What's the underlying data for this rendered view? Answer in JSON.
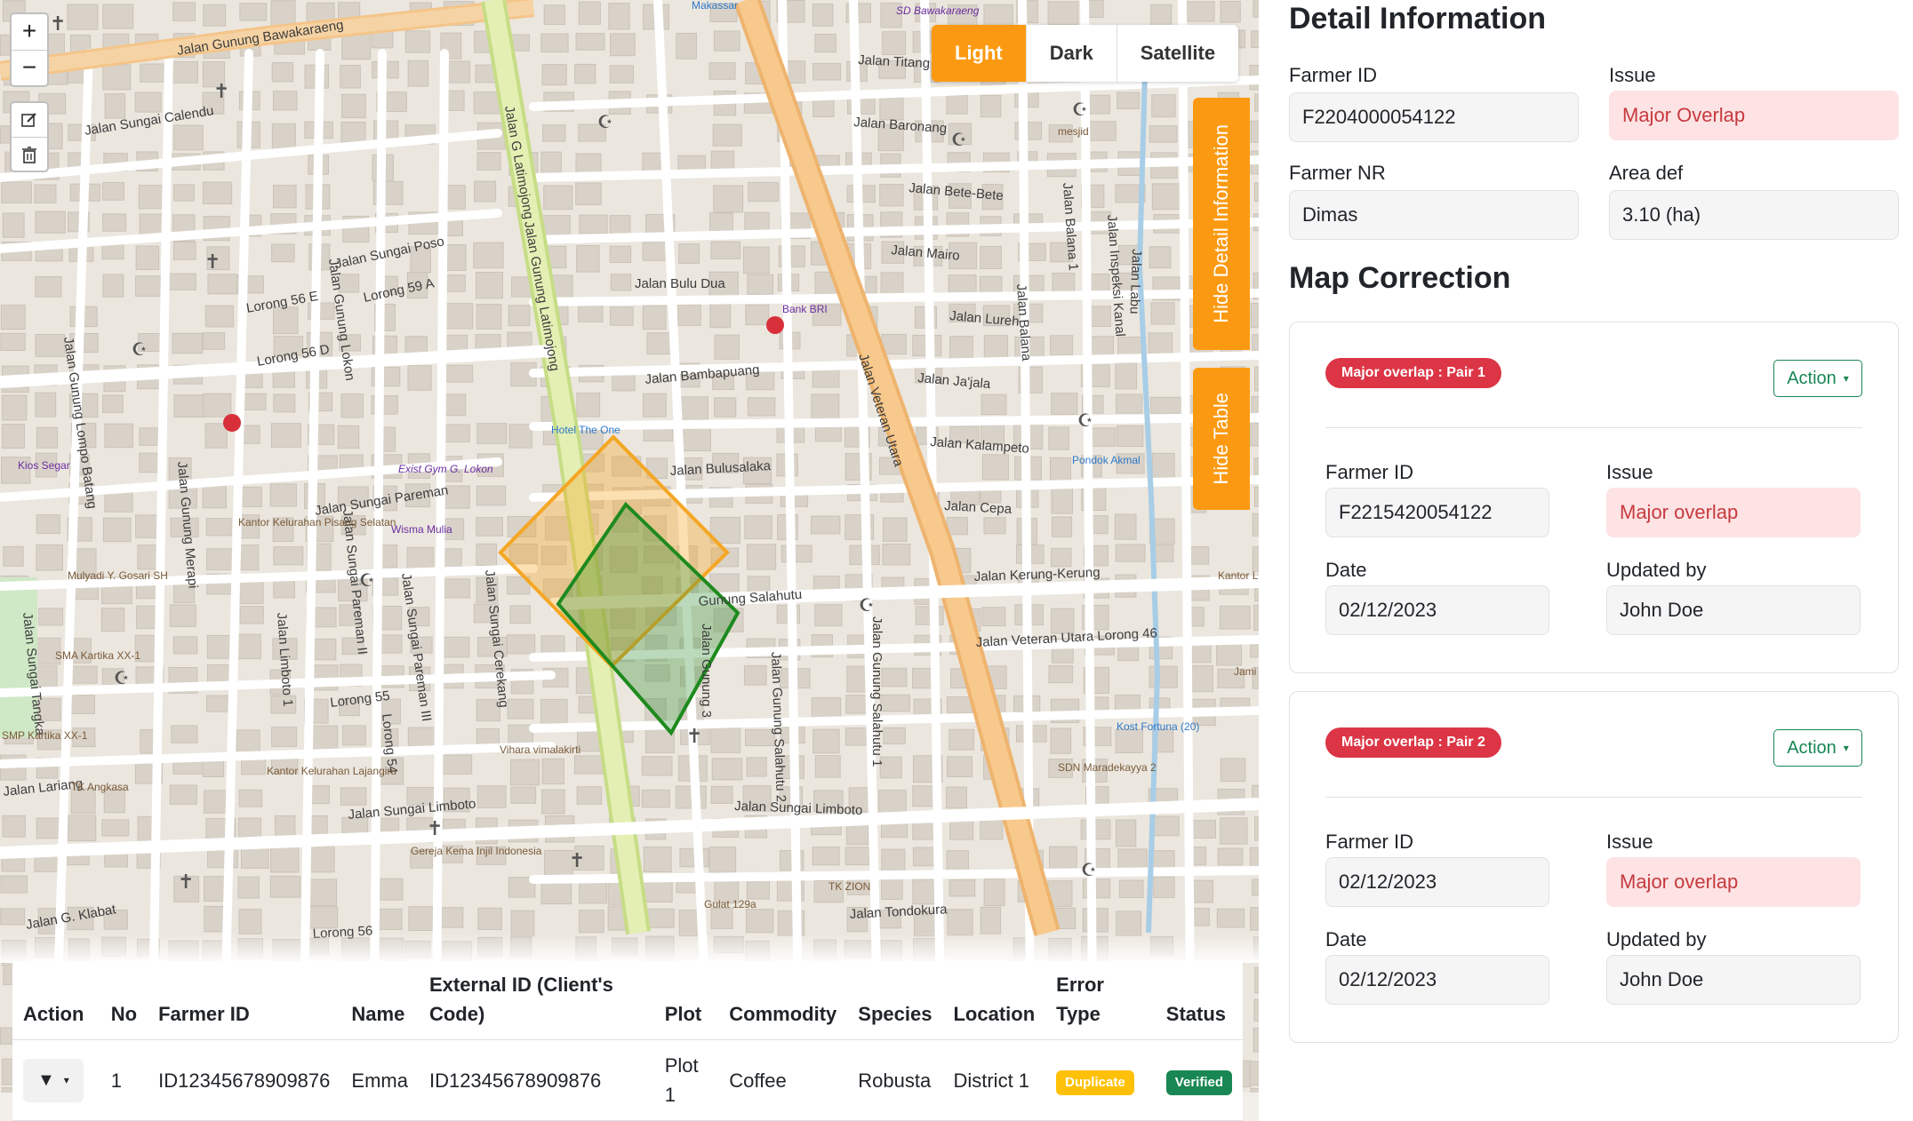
{
  "map": {
    "layers": [
      "Light",
      "Dark",
      "Satellite"
    ],
    "active_layer": "Light",
    "side_tabs": {
      "detail": "Hide Detail Information",
      "table": "Hide Table"
    },
    "zoom_in": "+",
    "zoom_out": "−",
    "streets": [
      "Jalan Gunung Bawakaraeng",
      "Jalan Titang",
      "Jalan Baronang",
      "Jalan Bete-Bete",
      "Jalan Mairo",
      "Jalan Lureh",
      "Jalan Ja'jala",
      "Jalan Kalampeto",
      "Jalan Cepa",
      "Jalan Kerung-Kerung",
      "Jalan Veteran Utara Lorong 46",
      "Jalan Sungai Calendu",
      "Jalan Sungai Poso",
      "Lorong 59 A",
      "Lorong 56 E",
      "Lorong 56 D",
      "Jalan Bulu Dua",
      "Jalan Bambapuang",
      "Jalan Bulusalaka",
      "Gunung Salahutu",
      "Jalan Sungai Pareman",
      "Lorong 55",
      "Jalan Sungai Limboto",
      "Jalan Sungai Limboto",
      "Jalan Tondokura",
      "Jalan G. Klabat",
      "Lorong 56",
      "Jalan Lariang",
      "Jalan Veteran Utara",
      "Jalan G Latimojong",
      "Jalan Gunung Latimojong",
      "Jalan Gunung Lokon",
      "Jalan Gunung Lompo Batang",
      "Jalan Gunung Merapi",
      "Jalan Sungai Pareman II",
      "Jalan Sungai Pareman III",
      "Jalan Sungai Cerekang",
      "Jalan Limboto 1",
      "Lorong 54",
      "Jalan Gunung Salahutu 2",
      "Jalan Gunung Salahutu 1",
      "Jalan Balana",
      "Jalan Balana 1",
      "Jalan Inspeksi Kanal",
      "Jalan Labu",
      "Jalan Sungai Tangka",
      "Jalan Gunung 3"
    ],
    "pois": [
      "SD Bawakaraeng",
      "Makassar",
      "mesjid",
      "Bank BRI",
      "Hotel The One",
      "Exist Gym G. Lokon",
      "Wisma Mulia",
      "Pondok Akmal",
      "Kantor Kelurahan Pisang Selatan",
      "Mulyadi Y. Gosari SH",
      "SMA Kartika XX-1",
      "SMP Kartika XX-1",
      "Kios Segar",
      "Kantor Kelurahan Lajangiru",
      "Vihara vimalakirti",
      "Gereja Kema Injil Indonesia",
      "SDN Maradekayya 2",
      "Kost Fortuna (20)",
      "TK ZION",
      "Gulat 129a",
      "TK Angkasa",
      "Kantor Lurah Maradeka Utara",
      "Jami"
    ]
  },
  "table": {
    "headers": [
      "Action",
      "No",
      "Farmer ID",
      "Name",
      "External ID (Client's Code)",
      "Plot",
      "Commodity",
      "Species",
      "Location",
      "Error Type",
      "Status"
    ],
    "rows": [
      {
        "action": "▼",
        "no": "1",
        "farmer_id": "ID12345678909876",
        "name": "Emma",
        "external_id": "ID12345678909876",
        "plot": "Plot 1",
        "commodity": "Coffee",
        "species": "Robusta",
        "location": "District 1",
        "error_type": "Duplicate",
        "status": "Verified"
      }
    ]
  },
  "detail": {
    "title": "Detail Information",
    "farmer_id_label": "Farmer ID",
    "farmer_id": "F2204000054122",
    "issue_label": "Issue",
    "issue": "Major Overlap",
    "farmer_nr_label": "Farmer NR",
    "farmer_nr": "Dimas",
    "area_label": "Area def",
    "area": "3.10 (ha)"
  },
  "correction": {
    "title": "Map Correction",
    "cards": [
      {
        "badge": "Major overlap : Pair 1",
        "action": "Action",
        "farmer_id_label": "Farmer ID",
        "farmer_id": "F2215420054122",
        "issue_label": "Issue",
        "issue": "Major overlap",
        "date_label": "Date",
        "date": "02/12/2023",
        "updated_label": "Updated by",
        "updated_by": "John Doe"
      },
      {
        "badge": "Major overlap : Pair 2",
        "action": "Action",
        "farmer_id_label": "Farmer ID",
        "farmer_id": "02/12/2023",
        "issue_label": "Issue",
        "issue": "Major overlap",
        "date_label": "Date",
        "date": "02/12/2023",
        "updated_label": "Updated by",
        "updated_by": "John Doe"
      }
    ]
  },
  "colors": {
    "accent": "#fb9a12",
    "danger": "#dc3545",
    "danger_bg": "#fde3e4",
    "success": "#198754",
    "warning": "#ffc107",
    "polygon_orange": "#f5a623",
    "polygon_green": "#1e8a1e"
  }
}
